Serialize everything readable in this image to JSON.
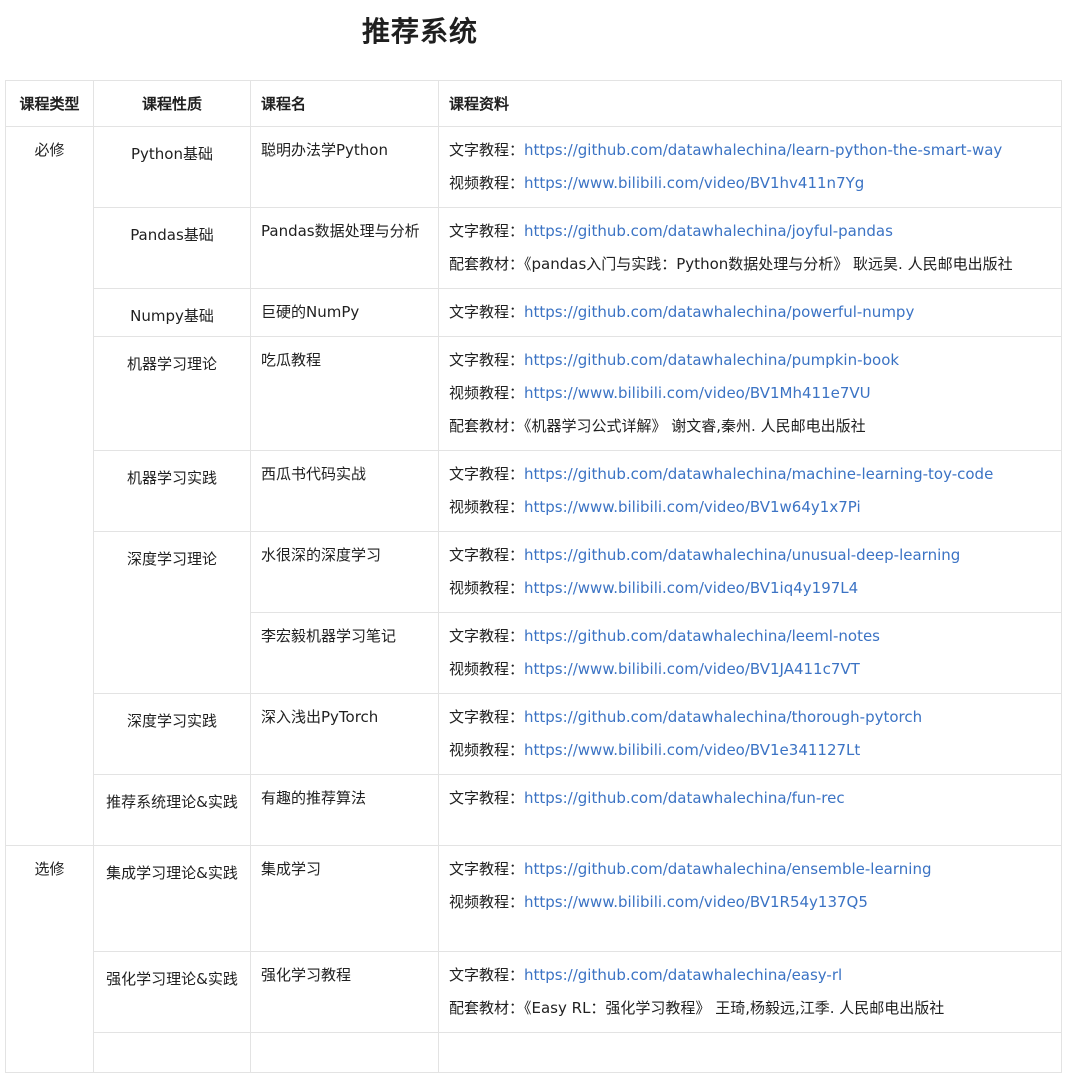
{
  "title": "推荐系统",
  "headers": {
    "type": "课程类型",
    "nature": "课程性质",
    "name": "课程名",
    "resources": "课程资料"
  },
  "rows": [
    {
      "type": "必修",
      "nature": "Python基础",
      "name": "聪明办法学Python",
      "resources": [
        {
          "label": "文字教程：",
          "link": "https://github.com/datawhalechina/learn-python-the-smart-way"
        },
        {
          "label": "视频教程：",
          "link": "https://www.bilibili.com/video/BV1hv411n7Yg"
        }
      ]
    },
    {
      "nature": "Pandas基础",
      "name": "Pandas数据处理与分析",
      "resources": [
        {
          "label": "文字教程：",
          "link": "https://github.com/datawhalechina/joyful-pandas"
        },
        {
          "label": "配套教材：",
          "text": "《pandas入门与实践：Python数据处理与分析》 耿远昊. 人民邮电出版社"
        }
      ]
    },
    {
      "nature": "Numpy基础",
      "name": "巨硬的NumPy",
      "resources": [
        {
          "label": "文字教程：",
          "link": "https://github.com/datawhalechina/powerful-numpy"
        }
      ]
    },
    {
      "nature": "机器学习理论",
      "name": "吃瓜教程",
      "resources": [
        {
          "label": "文字教程：",
          "link": "https://github.com/datawhalechina/pumpkin-book"
        },
        {
          "label": "视频教程：",
          "link": "https://www.bilibili.com/video/BV1Mh411e7VU"
        },
        {
          "label": "配套教材：",
          "text": "《机器学习公式详解》 谢文睿,秦州. 人民邮电出版社"
        }
      ]
    },
    {
      "nature": "机器学习实践",
      "name": "西瓜书代码实战",
      "resources": [
        {
          "label": "文字教程：",
          "link": "https://github.com/datawhalechina/machine-learning-toy-code"
        },
        {
          "label": "视频教程：",
          "link": "https://www.bilibili.com/video/BV1w64y1x7Pi"
        }
      ]
    },
    {
      "nature": "深度学习理论",
      "name": "水很深的深度学习",
      "resources": [
        {
          "label": "文字教程：",
          "link": "https://github.com/datawhalechina/unusual-deep-learning"
        },
        {
          "label": "视频教程：",
          "link": "https://www.bilibili.com/video/BV1iq4y197L4"
        }
      ]
    },
    {
      "name": "李宏毅机器学习笔记",
      "resources": [
        {
          "label": "文字教程：",
          "link": "https://github.com/datawhalechina/leeml-notes"
        },
        {
          "label": "视频教程：",
          "link": "https://www.bilibili.com/video/BV1JA411c7VT"
        }
      ]
    },
    {
      "nature": "深度学习实践",
      "name": "深入浅出PyTorch",
      "resources": [
        {
          "label": "文字教程：",
          "link": "https://github.com/datawhalechina/thorough-pytorch"
        },
        {
          "label": "视频教程：",
          "link": "https://www.bilibili.com/video/BV1e341127Lt"
        }
      ]
    },
    {
      "nature": "推荐系统理论&实践",
      "name": "有趣的推荐算法",
      "resources": [
        {
          "label": "文字教程：",
          "link": "https://github.com/datawhalechina/fun-rec"
        }
      ]
    },
    {
      "type": "选修",
      "nature": "集成学习理论&实践",
      "name": "集成学习",
      "resources": [
        {
          "label": "文字教程：",
          "link": "https://github.com/datawhalechina/ensemble-learning"
        },
        {
          "label": "视频教程：",
          "link": "https://www.bilibili.com/video/BV1R54y137Q5"
        }
      ]
    },
    {
      "nature": "强化学习理论&实践",
      "name": "强化学习教程",
      "resources": [
        {
          "label": "文字教程：",
          "link": "https://github.com/datawhalechina/easy-rl"
        },
        {
          "label": "配套教材：",
          "text": "《Easy RL：强化学习教程》 王琦,杨毅远,江季. 人民邮电出版社"
        }
      ]
    }
  ]
}
